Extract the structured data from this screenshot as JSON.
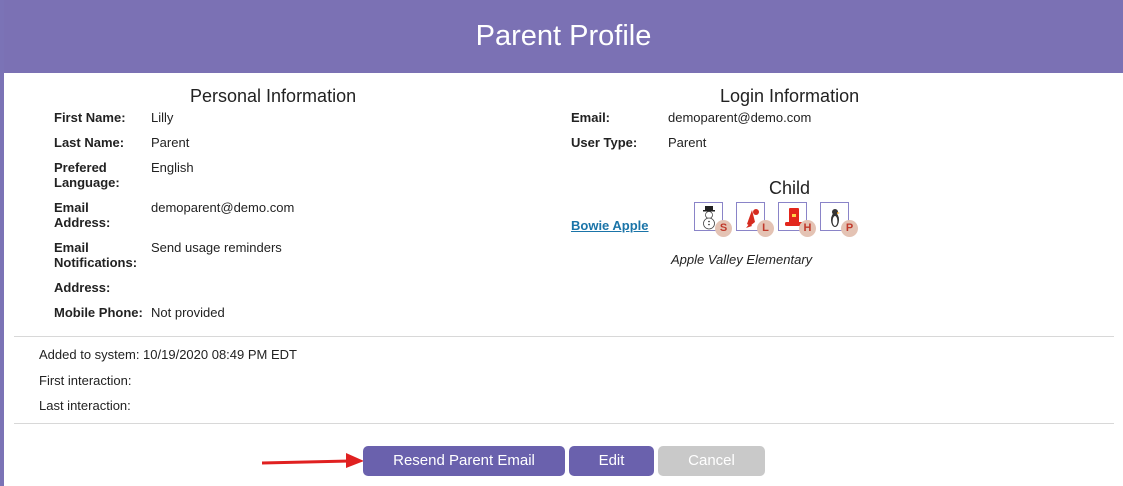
{
  "header": {
    "title": "Parent Profile"
  },
  "personal": {
    "title": "Personal Information",
    "first_name_label": "First Name:",
    "first_name": "Lilly",
    "last_name_label": "Last Name:",
    "last_name": "Parent",
    "language_label_1": "Prefered",
    "language_label_2": "Language:",
    "language": "English",
    "email_label_1": "Email",
    "email_label_2": "Address:",
    "email": "demoparent@demo.com",
    "notif_label_1": "Email",
    "notif_label_2": "Notifications:",
    "notifications": "Send usage reminders",
    "address_label": "Address:",
    "address": "",
    "mobile_label": "Mobile Phone:",
    "mobile": "Not provided"
  },
  "login": {
    "title": "Login Information",
    "email_label": "Email:",
    "email": "demoparent@demo.com",
    "user_type_label": "User Type:",
    "user_type": "Parent"
  },
  "child": {
    "title": "Child",
    "name": "Bowie Apple",
    "school": "Apple Valley Elementary",
    "badges": [
      {
        "letter": "S",
        "icon": "snowman-icon"
      },
      {
        "letter": "L",
        "icon": "lobster-icon"
      },
      {
        "letter": "H",
        "icon": "hat-icon"
      },
      {
        "letter": "P",
        "icon": "penguin-icon"
      }
    ]
  },
  "meta": {
    "added": "Added to system: 10/19/2020 08:49 PM EDT",
    "first": "First interaction:",
    "last": "Last interaction:"
  },
  "buttons": {
    "resend": "Resend Parent Email",
    "edit": "Edit",
    "cancel": "Cancel"
  },
  "colors": {
    "header": "#7b71b4",
    "primary_button": "#6a61ad",
    "disabled_button": "#c9c9c9",
    "link": "#1a74a8",
    "arrow": "#e02020"
  }
}
